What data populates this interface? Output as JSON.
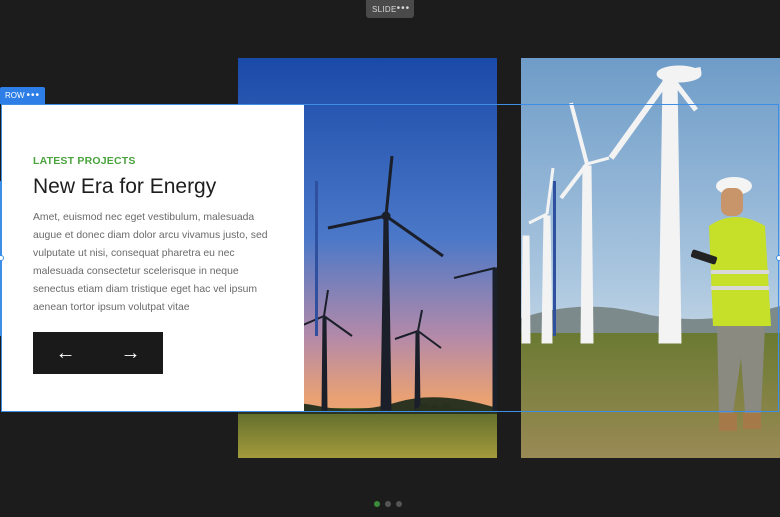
{
  "toolbar": {
    "slide_label": "SLIDE",
    "slide_menu": "•••"
  },
  "row": {
    "label": "ROW",
    "menu": "•••"
  },
  "card": {
    "eyebrow": "LATEST PROJECTS",
    "title": "New Era for Energy",
    "body": "Amet, euismod nec eget vestibulum, malesuada augue et donec diam dolor arcu vivamus justo, sed vulputate ut nisi, consequat pharetra eu nec malesuada consectetur scelerisque in neque senectus etiam diam tristique eget hac vel ipsum aenean tortor ipsum volutpat vitae",
    "prev_icon": "←",
    "next_icon": "→"
  },
  "images": [
    {
      "name": "wind-turbines-sunset-image"
    },
    {
      "name": "engineer-wind-farm-image"
    }
  ],
  "pagination": {
    "count": 3,
    "active_index": 0
  },
  "colors": {
    "accent_green": "#4aa33d",
    "selection_blue": "#3e8ee8",
    "background": "#1c1c1c"
  }
}
